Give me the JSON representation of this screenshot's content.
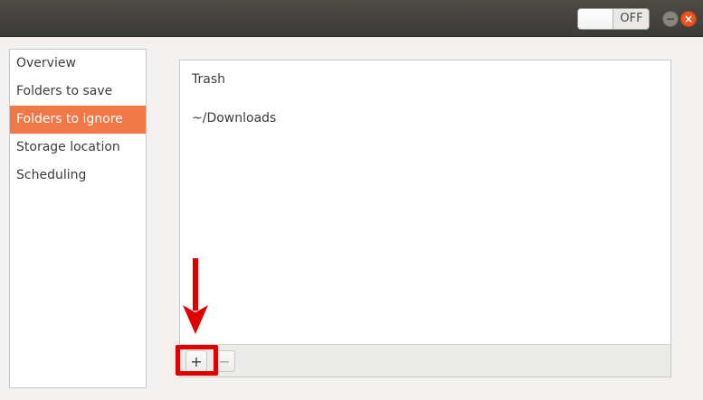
{
  "titlebar": {
    "toggle": {
      "state_label": "OFF"
    },
    "minimize_glyph": "−",
    "close_glyph": "×"
  },
  "sidebar": {
    "items": [
      {
        "label": "Overview",
        "selected": false
      },
      {
        "label": "Folders to save",
        "selected": false
      },
      {
        "label": "Folders to ignore",
        "selected": true
      },
      {
        "label": "Storage location",
        "selected": false
      },
      {
        "label": "Scheduling",
        "selected": false
      }
    ]
  },
  "ignore_list": {
    "items": [
      "Trash",
      "~/Downloads"
    ]
  },
  "toolbar": {
    "add_glyph": "+",
    "remove_glyph": "−"
  },
  "annotation": {
    "color": "#e00000",
    "icons": [
      "down-arrow",
      "highlight-box"
    ]
  },
  "colors": {
    "accent": "#f07746",
    "titlebar": "#3c3b37",
    "close": "#e95420"
  }
}
